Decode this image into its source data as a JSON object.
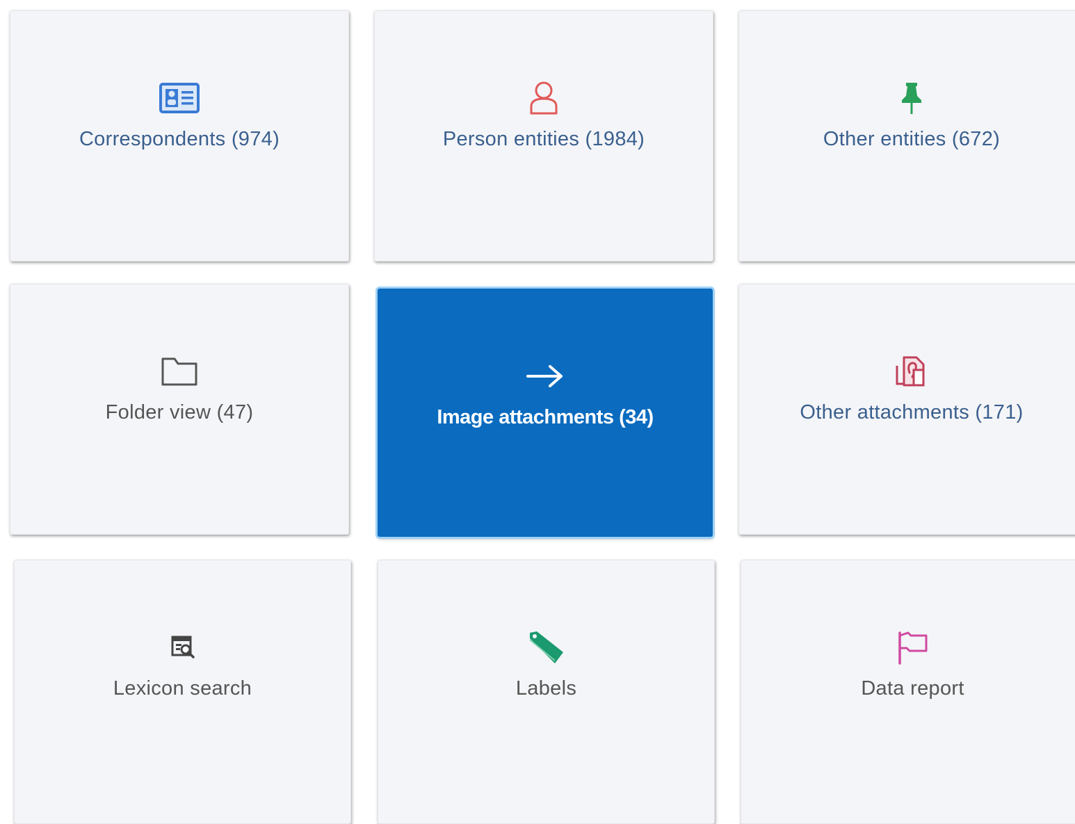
{
  "colors": {
    "tile_bg": "#f4f5f8",
    "active_bg": "#0a6bbf",
    "active_ring": "#9fd1f5",
    "text_blue": "#3a5f8e",
    "text_dark": "#555555",
    "active_text": "#ffffff"
  },
  "tiles": [
    {
      "label": "Correspondents (974)",
      "icon": "contact-card-icon",
      "icon_color": "#3a7bd5",
      "text_color": "#3a5f8e",
      "active": false
    },
    {
      "label": "Person entities (1984)",
      "icon": "person-icon",
      "icon_color": "#e05a5a",
      "text_color": "#3a5f8e",
      "active": false
    },
    {
      "label": "Other entities (672)",
      "icon": "pushpin-icon",
      "icon_color": "#2aa05a",
      "text_color": "#3a5f8e",
      "active": false
    },
    {
      "label": "Folder view (47)",
      "icon": "folder-icon",
      "icon_color": "#555555",
      "text_color": "#555555",
      "active": false
    },
    {
      "label": "Image attachments (34)",
      "icon": "arrow-right-icon",
      "icon_color": "#ffffff",
      "text_color": "#ffffff",
      "active": true
    },
    {
      "label": "Other attachments (171)",
      "icon": "attachments-icon",
      "icon_color": "#c0405a",
      "text_color": "#3a5f8e",
      "active": false
    },
    {
      "label": "Lexicon search",
      "icon": "lexicon-search-icon",
      "icon_color": "#444444",
      "text_color": "#555555",
      "active": false
    },
    {
      "label": "Labels",
      "icon": "tag-icon",
      "icon_color": "#1a9a6e",
      "text_color": "#555555",
      "active": false
    },
    {
      "label": "Data report",
      "icon": "flag-icon",
      "icon_color": "#d04aa0",
      "text_color": "#555555",
      "active": false
    }
  ]
}
